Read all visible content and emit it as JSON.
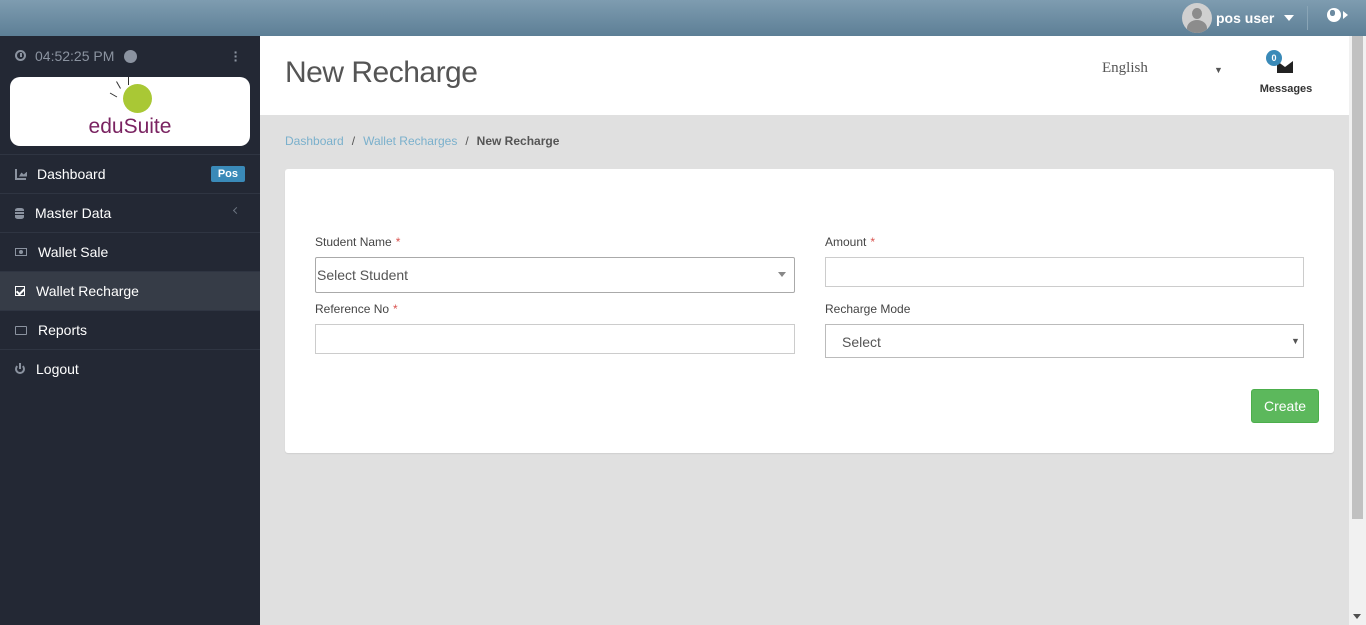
{
  "topbar": {
    "user_name": "pos user"
  },
  "sidebar": {
    "time": "04:52:25 PM",
    "logo_text": "eduSuite",
    "items": [
      {
        "label": "Dashboard",
        "badge": "Pos",
        "icon": "area-chart-icon"
      },
      {
        "label": "Master Data",
        "icon": "database-icon"
      },
      {
        "label": "Wallet Sale",
        "icon": "money-icon"
      },
      {
        "label": "Wallet Recharge",
        "icon": "check-square-icon",
        "active": true
      },
      {
        "label": "Reports",
        "icon": "folder-open-icon"
      },
      {
        "label": "Logout",
        "icon": "power-icon"
      }
    ]
  },
  "header": {
    "title": "New Recharge",
    "language": "English",
    "messages_count": "0",
    "messages_label": "Messages"
  },
  "breadcrumb": {
    "items": [
      "Dashboard",
      "Wallet Recharges"
    ],
    "current": "New Recharge"
  },
  "form": {
    "student_name_label": "Student Name",
    "student_placeholder": "Select Student",
    "amount_label": "Amount",
    "amount_value": "",
    "reference_label": "Reference No",
    "reference_value": "",
    "recharge_mode_label": "Recharge Mode",
    "recharge_mode_selected": "Select",
    "required_mark": "*",
    "create_label": "Create"
  },
  "colors": {
    "topbar": "#6c8ba1",
    "sidebar": "#232834",
    "accent_blue": "#3a8ab8",
    "create_green": "#5cb85c",
    "logo_purple": "#7a2361",
    "logo_green": "#a9c835"
  }
}
